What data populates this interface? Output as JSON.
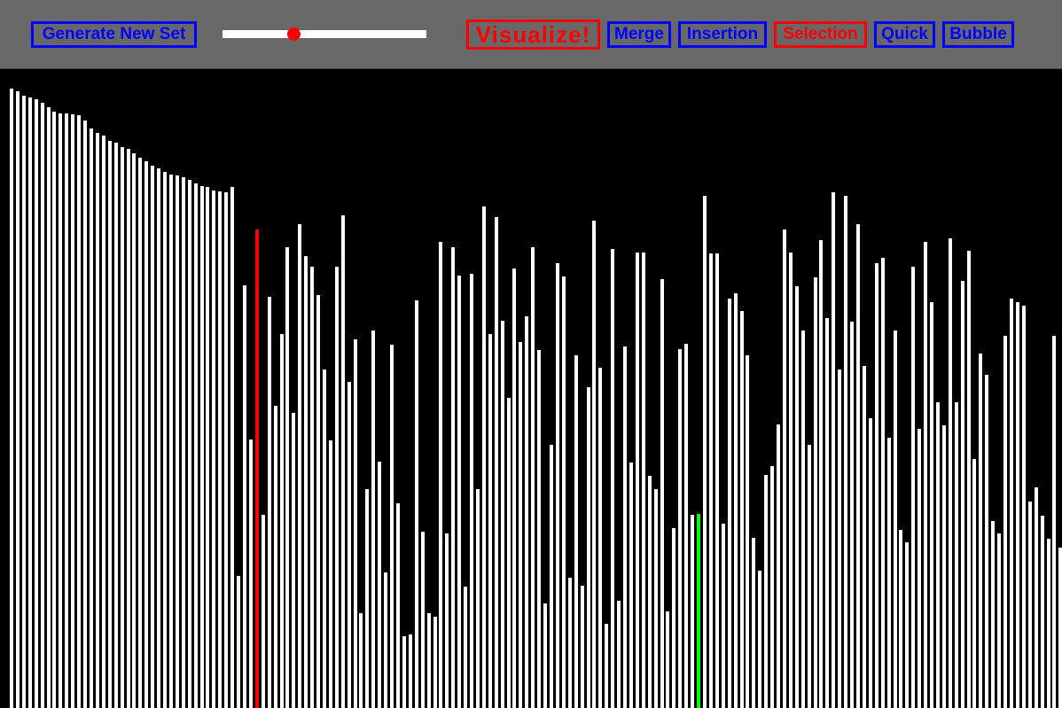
{
  "toolbar": {
    "generate_label": "Generate New Set",
    "visualize_label": "Visualize!",
    "algorithms": [
      {
        "label": "Merge",
        "active": false
      },
      {
        "label": "Insertion",
        "active": false
      },
      {
        "label": "Selection",
        "active": true
      },
      {
        "label": "Quick",
        "active": false
      },
      {
        "label": "Bubble",
        "active": false
      }
    ],
    "speed_fraction": 0.35
  },
  "colors": {
    "toolbar_bg": "#686868",
    "button_blue": "#0000ff",
    "button_red": "#ff0000",
    "bar_default": "#ffffff",
    "bar_current": "#ff0000",
    "bar_compare": "#00ff00",
    "slider_thumb": "#ff0000"
  },
  "visualization": {
    "max_value": 700,
    "current_index": 40,
    "compare_index": 112,
    "values": [
      700,
      697,
      692,
      690,
      688,
      684,
      679,
      674,
      672,
      672,
      671,
      670,
      664,
      655,
      650,
      647,
      641,
      639,
      634,
      632,
      627,
      622,
      618,
      613,
      610,
      606,
      603,
      602,
      600,
      597,
      593,
      590,
      589,
      585,
      584,
      583,
      589,
      149,
      478,
      303,
      541,
      218,
      465,
      341,
      423,
      521,
      333,
      547,
      511,
      499,
      467,
      383,
      302,
      499,
      557,
      369,
      417,
      107,
      247,
      427,
      278,
      153,
      411,
      231,
      81,
      83,
      461,
      199,
      107,
      103,
      527,
      197,
      521,
      489,
      137,
      491,
      247,
      567,
      423,
      555,
      438,
      351,
      497,
      414,
      443,
      521,
      405,
      118,
      297,
      503,
      488,
      147,
      399,
      138,
      363,
      551,
      385,
      95,
      519,
      121,
      409,
      277,
      515,
      515,
      262,
      247,
      485,
      109,
      203,
      406,
      412,
      218,
      219,
      579,
      514,
      514,
      208,
      463,
      469,
      449,
      399,
      192,
      155,
      263,
      273,
      320,
      541,
      515,
      477,
      427,
      297,
      487,
      529,
      441,
      583,
      383,
      579,
      437,
      547,
      387,
      327,
      503,
      509,
      305,
      427,
      201,
      187,
      499,
      315,
      527,
      459,
      345,
      319,
      531,
      345,
      483,
      517,
      281,
      401,
      377,
      211,
      197,
      421,
      463,
      459,
      455,
      233,
      249,
      217,
      191,
      421,
      181,
      449,
      405
    ]
  }
}
